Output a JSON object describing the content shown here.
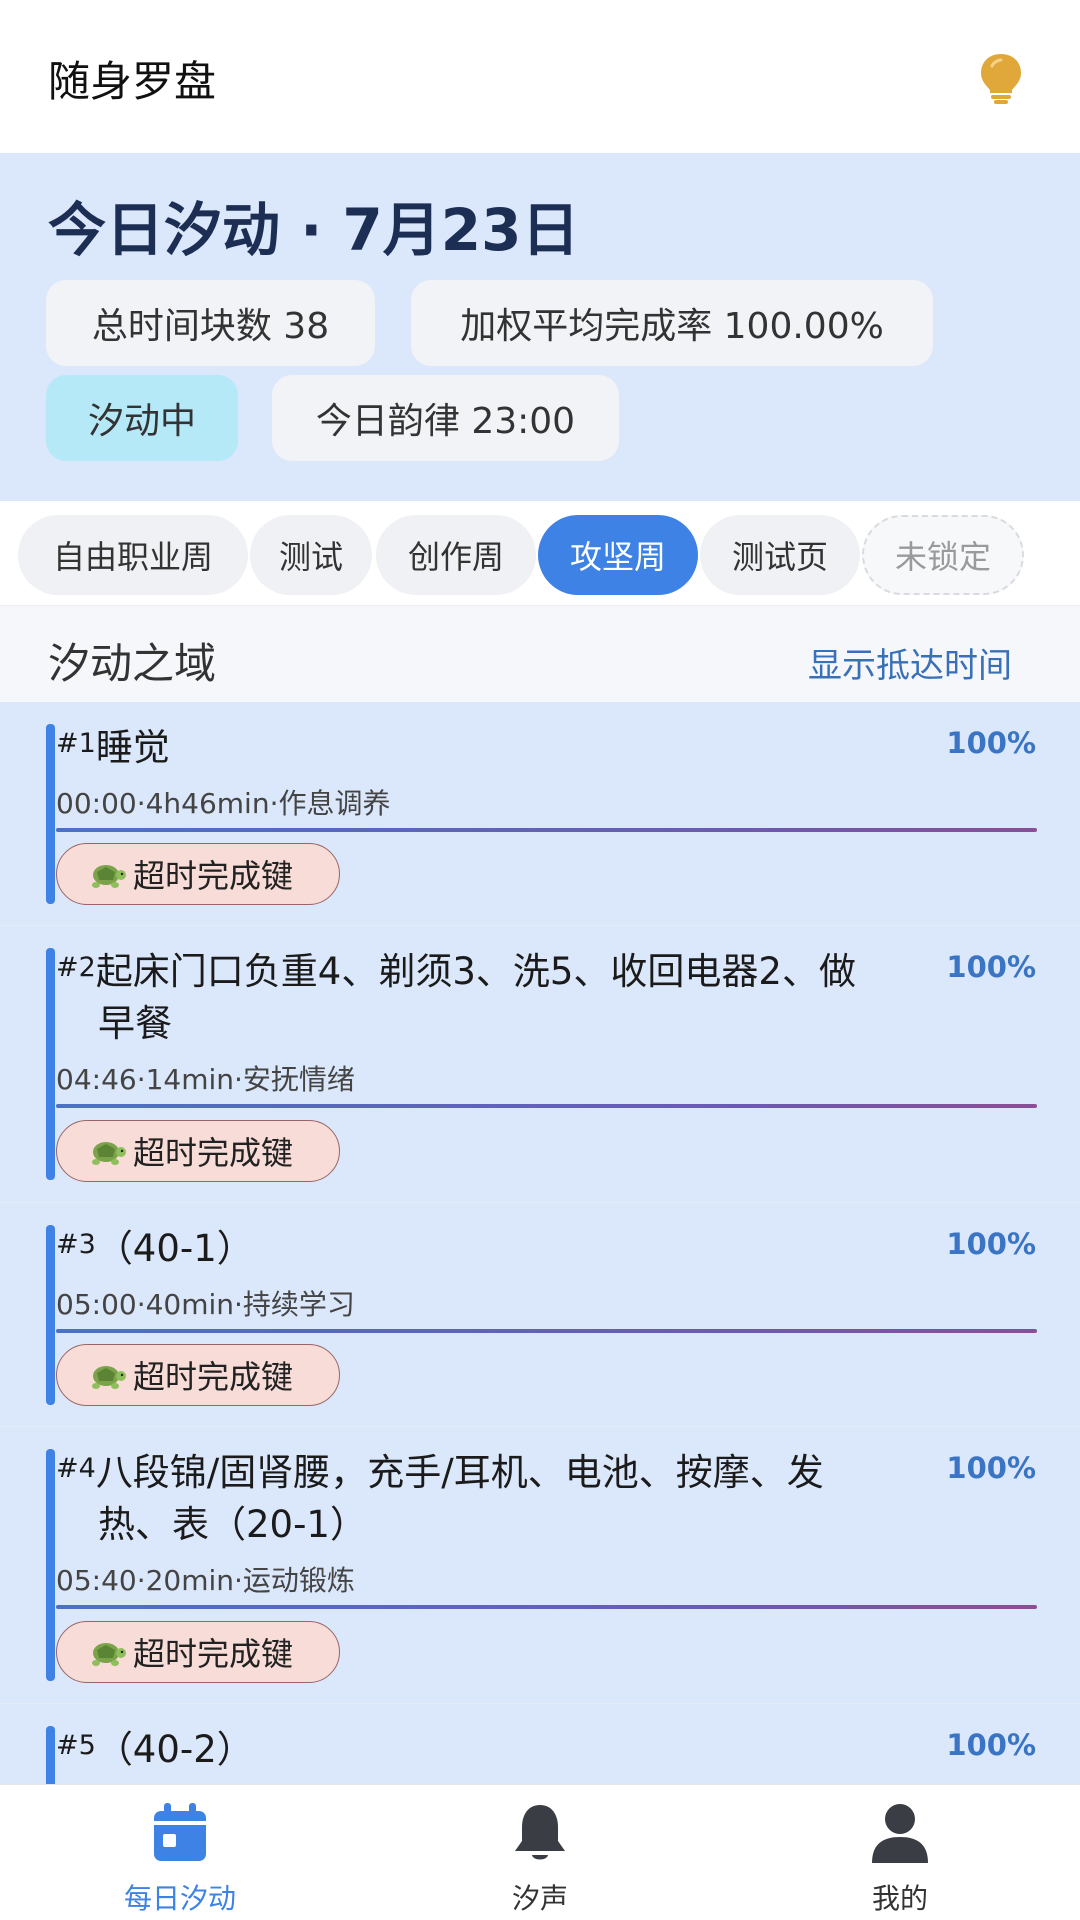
{
  "header": {
    "title": "随身罗盘",
    "bulb_icon": "lightbulb-icon",
    "bulb_color": "#e0a83a"
  },
  "summary": {
    "title": "今日汐动 · 7月23日",
    "total_blocks": "总时间块数 38",
    "weighted_rate": "加权平均完成率 100.00%",
    "status": "汐动中",
    "rhythm": "今日韵律 23:00"
  },
  "tabs": [
    {
      "label": "自由职业周"
    },
    {
      "label": "测试"
    },
    {
      "label": "创作周"
    },
    {
      "label": "攻坚周"
    },
    {
      "label": "测试页"
    },
    {
      "label": "未锁定"
    }
  ],
  "section": {
    "title": "汐动之域",
    "toggle_label": "显示抵达时间"
  },
  "tasks": [
    {
      "index": "#1",
      "title": "睡觉",
      "title_line2": "",
      "meta": "00:00·4h46min·作息调养",
      "percent": "100%",
      "button": "超时完成键"
    },
    {
      "index": "#2",
      "title": "起床门口负重4、剃须3、洗5、收回电器2、做",
      "title_line2": "早餐",
      "meta": "04:46·14min·安抚情绪",
      "percent": "100%",
      "button": "超时完成键"
    },
    {
      "index": "#3",
      "title": "（40-1）",
      "title_line2": "",
      "meta": "05:00·40min·持续学习",
      "percent": "100%",
      "button": "超时完成键"
    },
    {
      "index": "#4",
      "title": "八段锦/固肾腰，充手/耳机、电池、按摩、发",
      "title_line2": "热、表（20-1）",
      "meta": "05:40·20min·运动锻炼",
      "percent": "100%",
      "button": "超时完成键"
    },
    {
      "index": "#5",
      "title": "（40-2）",
      "title_line2": "",
      "meta": "",
      "percent": "100%",
      "button": ""
    }
  ],
  "bottom_nav": [
    {
      "label": "每日汐动",
      "icon": "calendar-icon"
    },
    {
      "label": "汐声",
      "icon": "bell-icon"
    },
    {
      "label": "我的",
      "icon": "user-icon"
    }
  ],
  "colors": {
    "accent": "#3d82e4",
    "summary_bg": "#dbe7fa",
    "active_status": "#b6e9f8",
    "button_bg": "#f7dcd7"
  }
}
